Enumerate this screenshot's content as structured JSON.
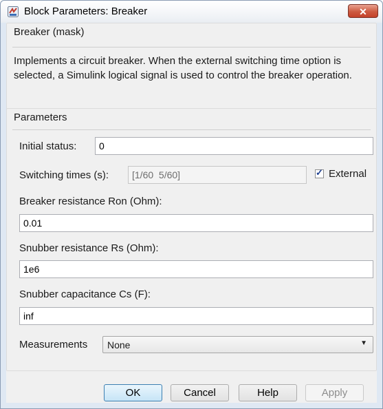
{
  "window": {
    "title": "Block Parameters: Breaker",
    "close_label": "✕"
  },
  "mask_group": {
    "title": "Breaker (mask)",
    "description": "Implements a circuit breaker. When the external switching time option is selected, a Simulink logical signal is used to control the breaker operation."
  },
  "parameters_group": {
    "title": "Parameters",
    "initial_status": {
      "label": "Initial status:",
      "value": "0"
    },
    "switching_times": {
      "label": "Switching times (s):",
      "value": "[1/60  5/60]",
      "external_label": "External",
      "external_checked": true
    },
    "breaker_resistance": {
      "label": "Breaker resistance Ron (Ohm):",
      "value": "0.01"
    },
    "snubber_resistance": {
      "label": "Snubber resistance Rs (Ohm):",
      "value": "1e6"
    },
    "snubber_capacitance": {
      "label": "Snubber capacitance Cs (F):",
      "value": "inf"
    },
    "measurements": {
      "label": "Measurements",
      "value": "None"
    }
  },
  "buttons": {
    "ok": "OK",
    "cancel": "Cancel",
    "help": "Help",
    "apply": "Apply"
  },
  "icons": {
    "app": "simulink-block-icon",
    "close": "close-icon",
    "dropdown": "chevron-down-icon",
    "check": "checkmark-icon"
  }
}
